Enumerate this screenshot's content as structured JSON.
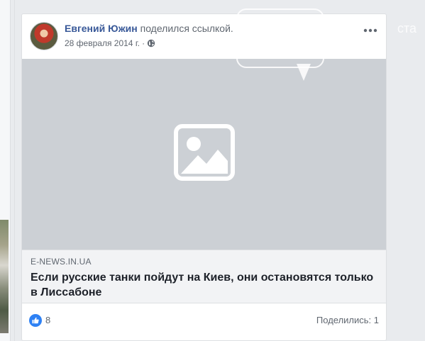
{
  "post": {
    "author_name": "Евгений Южин",
    "action_text": "поделился ссылкой.",
    "date": "28 февраля 2014 г.",
    "separator": "·",
    "privacy_icon": "globe-icon",
    "more_icon": "more-options-icon"
  },
  "link": {
    "image_placeholder_icon": "image-placeholder-icon",
    "domain": "E-NEWS.IN.UA",
    "title": "Если русские танки пойдут на Киев, они остановятся только в Лиссабоне"
  },
  "reactions": {
    "like_icon": "like-icon",
    "like_count": "8",
    "shares_text": "Поделились: 1"
  },
  "watermark": {
    "text": "ста"
  },
  "colors": {
    "page_background": "#e9ebee",
    "author_link": "#385898",
    "placeholder_gray": "#ccd0d5",
    "like_blue": "#2e81f4",
    "secondary_text": "#606770"
  }
}
